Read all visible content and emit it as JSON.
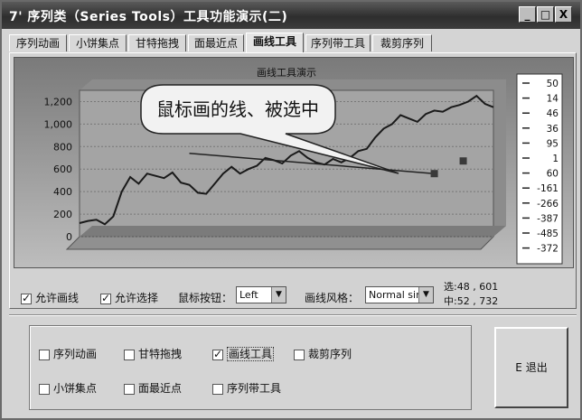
{
  "window": {
    "title": "序列类（Series Tools）工具功能演示(二)",
    "title_icon": "7'",
    "buttons": [
      "_",
      "□",
      "X"
    ]
  },
  "tabs": [
    {
      "label": "序列动画",
      "active": false
    },
    {
      "label": "小饼集点",
      "active": false
    },
    {
      "label": "甘特拖拽",
      "active": false
    },
    {
      "label": "面最近点",
      "active": false
    },
    {
      "label": "画线工具",
      "active": true
    },
    {
      "label": "序列带工具",
      "active": false
    },
    {
      "label": "裁剪序列",
      "active": false
    }
  ],
  "chart_data": {
    "type": "line",
    "title": "画线工具演示",
    "yticks": [
      "1,200",
      "1,000",
      "800",
      "600",
      "400",
      "200",
      "0"
    ],
    "ylim": [
      0,
      1300
    ],
    "x": [
      1,
      2,
      3,
      4,
      5,
      6,
      7,
      8,
      9,
      10,
      11,
      12,
      13,
      14,
      15,
      16,
      17,
      18,
      19,
      20,
      21,
      22,
      23,
      24,
      25,
      26,
      27,
      28,
      29,
      30,
      31,
      32,
      33,
      34,
      35,
      36,
      37,
      38,
      39,
      40,
      41,
      42,
      43,
      44,
      45,
      46,
      47,
      48,
      49,
      50
    ],
    "values": [
      120,
      140,
      150,
      110,
      180,
      400,
      530,
      470,
      560,
      540,
      520,
      570,
      480,
      460,
      390,
      380,
      470,
      560,
      620,
      560,
      600,
      630,
      700,
      680,
      650,
      720,
      760,
      700,
      660,
      640,
      690,
      660,
      700,
      760,
      780,
      880,
      960,
      1000,
      1080,
      1050,
      1020,
      1090,
      1120,
      1110,
      1150,
      1170,
      1200,
      1250,
      1180,
      1150
    ],
    "legend_values": [
      "50",
      "14",
      "46",
      "36",
      "95",
      "1",
      "60",
      "-161",
      "-266",
      "-387",
      "-485",
      "-372"
    ],
    "annotation": "鼠标画的线、被选中",
    "drawn_line": {
      "x1": 14,
      "y1": 740,
      "x2": 43,
      "y2": 560
    },
    "grid": true
  },
  "controls": {
    "allow_draw": {
      "label": "允许画线",
      "checked": true
    },
    "allow_select": {
      "label": "允许选择",
      "checked": true
    },
    "mouse_button_label": "鼠标按钮：",
    "mouse_button_value": "Left",
    "line_style_label": "画线风格：",
    "line_style_value": "Normal sin",
    "readout_start": "选:48 , 601",
    "readout_mid": "中:52 , 732"
  },
  "group_checks": [
    {
      "label": "序列动画",
      "checked": false
    },
    {
      "label": "甘特拖拽",
      "checked": false
    },
    {
      "label": "画线工具",
      "checked": true
    },
    {
      "label": "裁剪序列",
      "checked": false
    },
    {
      "label": "小饼集点",
      "checked": false
    },
    {
      "label": "面最近点",
      "checked": false
    },
    {
      "label": "序列带工具",
      "checked": false
    }
  ],
  "exit_button": {
    "label": "E 退出"
  }
}
